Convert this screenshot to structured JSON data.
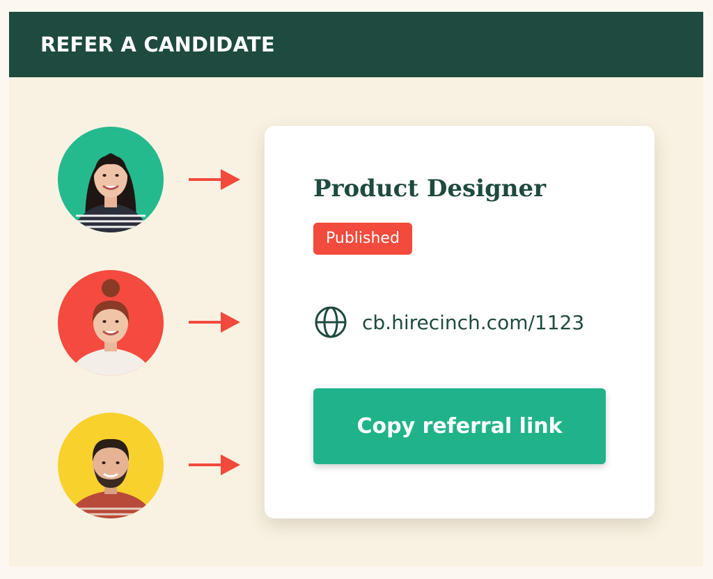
{
  "header": {
    "title": "REFER A CANDIDATE"
  },
  "candidates": [
    {
      "avatar_background": "#25b98e"
    },
    {
      "avatar_background": "#f54a3f"
    },
    {
      "avatar_background": "#f9d12c"
    }
  ],
  "job": {
    "title": "Product Designer",
    "status": "Published",
    "link": "cb.hirecinch.com/1123",
    "copy_button_label": "Copy referral link"
  },
  "icons": {
    "link": "globe-icon",
    "connector": "arrow-right-icon"
  },
  "colors": {
    "header_bg": "#1e4a3f",
    "panel_bg": "#f9f2e2",
    "accent_green": "#20b38a",
    "badge_red": "#f24a3c",
    "arrow_red": "#f24a3c",
    "text_dark_green": "#1e4a3f"
  }
}
